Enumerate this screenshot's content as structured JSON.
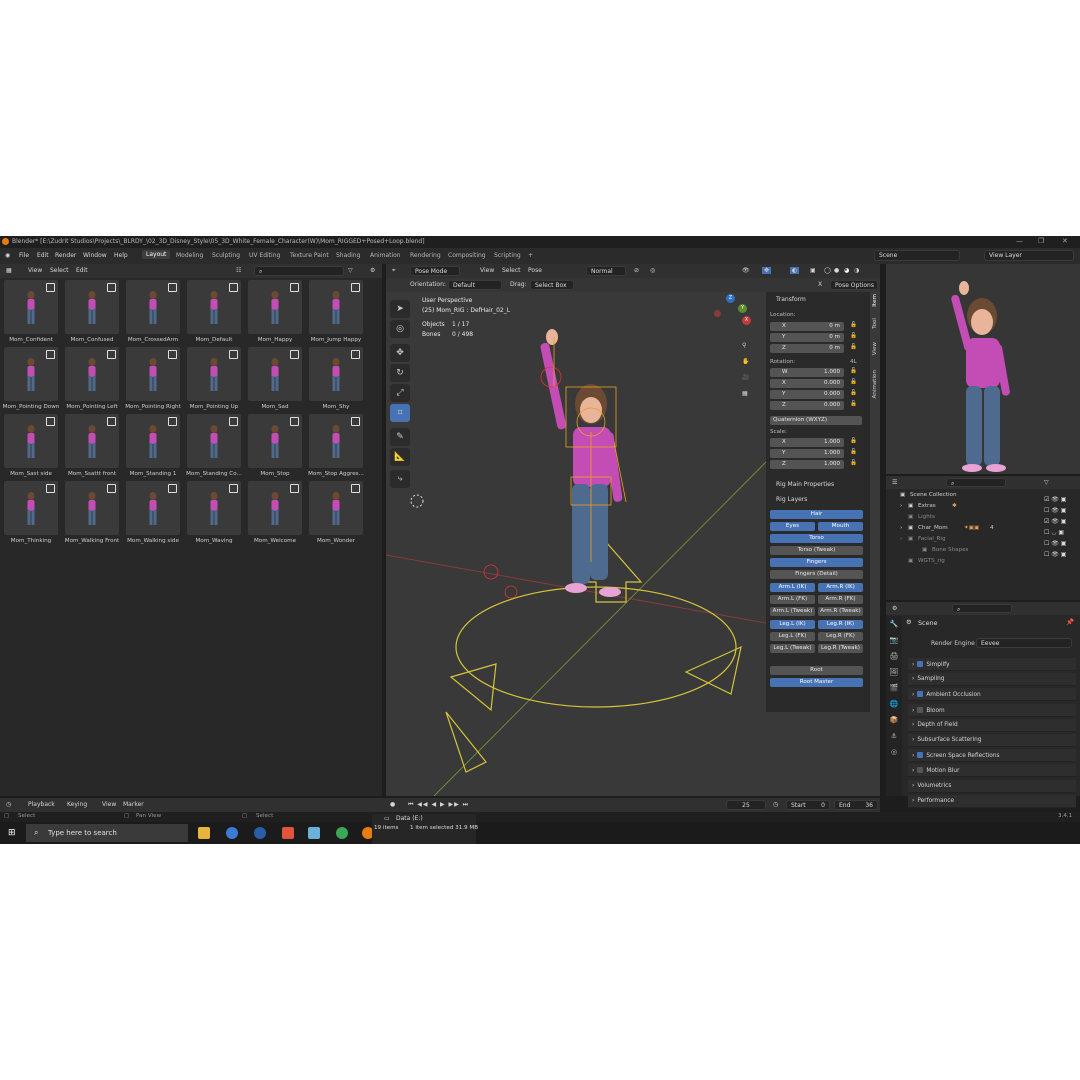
{
  "window": {
    "title": "Blender* [E:\\Zudrit Studios\\Projects\\_BLRDY_\\02_3D_Disney_Style\\05_3D_White_Female_Character(W)\\Mom_RIGGED+Posed+Loop.blend]"
  },
  "menu": {
    "items": [
      "File",
      "Edit",
      "Render",
      "Window",
      "Help"
    ]
  },
  "workspaces": {
    "active": "Layout",
    "items": [
      "Modeling",
      "Sculpting",
      "UV Editing",
      "Texture Paint",
      "Shading",
      "Animation",
      "Rendering",
      "Compositing",
      "Scripting",
      "+"
    ]
  },
  "topright": {
    "scene": "Scene",
    "view_layer": "View Layer"
  },
  "asset_browser": {
    "menu": [
      "View",
      "Select",
      "Edit"
    ],
    "assets": [
      "Mom_Confident",
      "Mom_Confused",
      "Mom_CrossedArm",
      "Mom_Default",
      "Mom_Happy",
      "Mom_Jump Happy",
      "Mom_Pointing Down",
      "Mom_Pointing Left",
      "Mom_Pointing Right",
      "Mom_Pointing Up",
      "Mom_Sad",
      "Mom_Shy",
      "Mom_Sast side",
      "Mom_Ssattt front",
      "Mom_Standing 1",
      "Mom_Standing Co...",
      "Mom_Stop",
      "Mom_Stop Aggres...",
      "Mom_Thinking",
      "Mom_Walking Front",
      "Mom_Walking side",
      "Mom_Waving",
      "Mom_Welcome",
      "Mom_Wonder"
    ]
  },
  "viewport": {
    "mode": "Pose Mode",
    "menu": [
      "View",
      "Select",
      "Pose"
    ],
    "transform_space": "Normal",
    "orientation_label": "Orientation:",
    "orientation": "Default",
    "drag_label": "Drag:",
    "drag": "Select Box",
    "pose_options": "Pose Options",
    "overlay": {
      "perspective": "User Perspective",
      "active": "(25) Mom_RIG : DefHair_02_L",
      "objects_label": "Objects",
      "objects": "1 / 17",
      "bones_label": "Bones",
      "bones": "0 / 498"
    },
    "gizmo": {
      "x": "X",
      "y": "Y",
      "z": "Z"
    }
  },
  "npanel": {
    "tabs": [
      "Item",
      "Tool",
      "View",
      "Animation"
    ],
    "transform": "Transform",
    "location_label": "Location:",
    "location": [
      {
        "axis": "X",
        "value": "0 m"
      },
      {
        "axis": "Y",
        "value": "0 m"
      },
      {
        "axis": "Z",
        "value": "0 m"
      }
    ],
    "rotation_label": "Rotation:",
    "rotation_flag": "4L",
    "rotation": [
      {
        "axis": "W",
        "value": "1.000"
      },
      {
        "axis": "X",
        "value": "0.000"
      },
      {
        "axis": "Y",
        "value": "0.000"
      },
      {
        "axis": "Z",
        "value": "0.000"
      }
    ],
    "rotation_mode": "Quaternion (WXYZ)",
    "scale_label": "Scale:",
    "scale": [
      {
        "axis": "X",
        "value": "1.000"
      },
      {
        "axis": "Y",
        "value": "1.000"
      },
      {
        "axis": "Z",
        "value": "1.000"
      }
    ],
    "rig_main": "Rig Main Properties",
    "rig_layers": "Rig Layers",
    "layers": {
      "hair": "Hair",
      "eyes": "Eyes",
      "mouth": "Mouth",
      "torso": "Torso",
      "torso_tweak": "Torso (Tweak)",
      "fingers": "Fingers",
      "fingers_detail": "Fingers (Detail)",
      "arm_l_ik": "Arm.L (IK)",
      "arm_r_ik": "Arm.R (IK)",
      "arm_l_fk": "Arm.L (FK)",
      "arm_r_fk": "Arm.R (FK)",
      "arm_l_tweak": "Arm.L (Tweak)",
      "arm_r_tweak": "Arm.R (Tweak)",
      "leg_l_ik": "Leg.L (IK)",
      "leg_r_ik": "Leg.R (IK)",
      "leg_l_fk": "Leg.L (FK)",
      "leg_r_fk": "Leg.R (FK)",
      "leg_l_tweak": "Leg.L (Tweak)",
      "leg_r_tweak": "Leg.R (Tweak)",
      "root": "Root",
      "root_master": "Root Master"
    }
  },
  "outliner": {
    "rows": [
      "Scene Collection",
      "Extras",
      "Lights",
      "Char_Mom",
      "Facial_Rig",
      "Bone Shapes",
      "WGTS_rig"
    ],
    "badge": "4"
  },
  "properties": {
    "scene": "Scene",
    "render_engine_label": "Render Engine",
    "render_engine": "Eevee",
    "sections": [
      {
        "label": "Simplify",
        "check": "on"
      },
      {
        "label": "Sampling",
        "check": "none"
      },
      {
        "label": "Ambient Occlusion",
        "check": "on"
      },
      {
        "label": "Bloom",
        "check": "off"
      },
      {
        "label": "Depth of Field",
        "check": "none"
      },
      {
        "label": "Subsurface Scattering",
        "check": "none"
      },
      {
        "label": "Screen Space Reflections",
        "check": "on"
      },
      {
        "label": "Motion Blur",
        "check": "off"
      },
      {
        "label": "Volumetrics",
        "check": "none"
      },
      {
        "label": "Performance",
        "check": "none"
      }
    ]
  },
  "timeline": {
    "menu": [
      "Playback",
      "Keying",
      "View",
      "Marker"
    ],
    "current_frame": "25",
    "start_label": "Start",
    "start": "0",
    "end_label": "End",
    "end": "36"
  },
  "status": {
    "select": "Select",
    "pan": "Pan View",
    "select2": "Select",
    "drive": "Data (E:)",
    "items": "19 items",
    "selected": "1 item selected  31.9 MB",
    "version": "3.4.1"
  },
  "taskbar": {
    "search_placeholder": "Type here to search"
  }
}
